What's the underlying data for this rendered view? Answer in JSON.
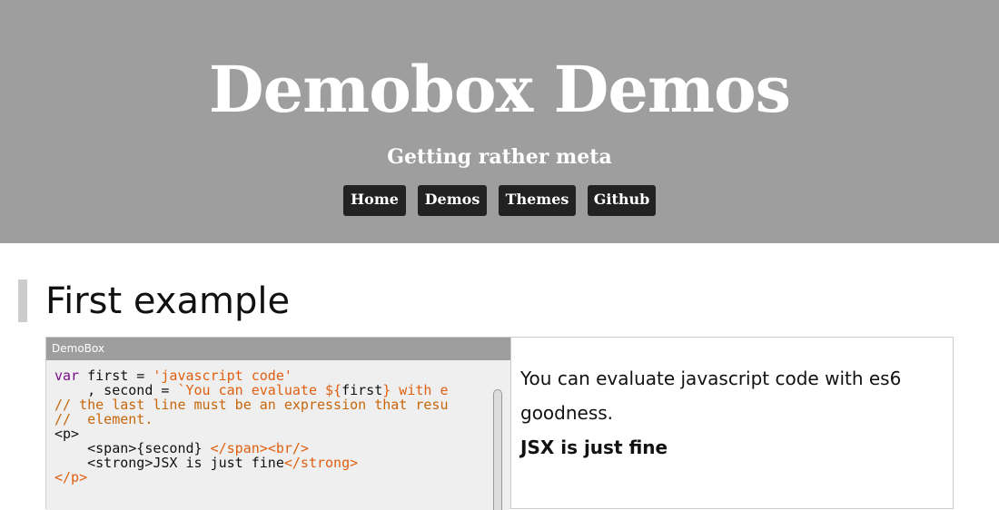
{
  "header": {
    "title": "Demobox Demos",
    "subtitle": "Getting rather meta",
    "nav": [
      "Home",
      "Demos",
      "Themes",
      "Github"
    ]
  },
  "section": {
    "title": "First example"
  },
  "demobox": {
    "title": "DemoBox",
    "code": {
      "line1_kw": "var",
      "line1_mid": " first = ",
      "line1_str": "'javascript code'",
      "line2_pre": "    , second = ",
      "line2_str1": "`You can evaluate ${",
      "line2_var": "first",
      "line2_str2": "} with e",
      "line3": "// the last line must be an expression that resu",
      "line4": "//  element.",
      "line5": "<p>",
      "line6_pre": "    <span>{second} ",
      "line6_close": "</span>",
      "line6_br": "<br/>",
      "line7_pre": "    <strong>JSX is just fine",
      "line7_close": "</strong>",
      "line8": "</p>"
    },
    "output": {
      "text": "You can evaluate javascript code with es6 goodness.",
      "strong": "JSX is just fine"
    }
  },
  "colors": {
    "header_bg": "#9e9e9e",
    "nav_bg": "#222222",
    "editor_bg": "#efefef"
  }
}
